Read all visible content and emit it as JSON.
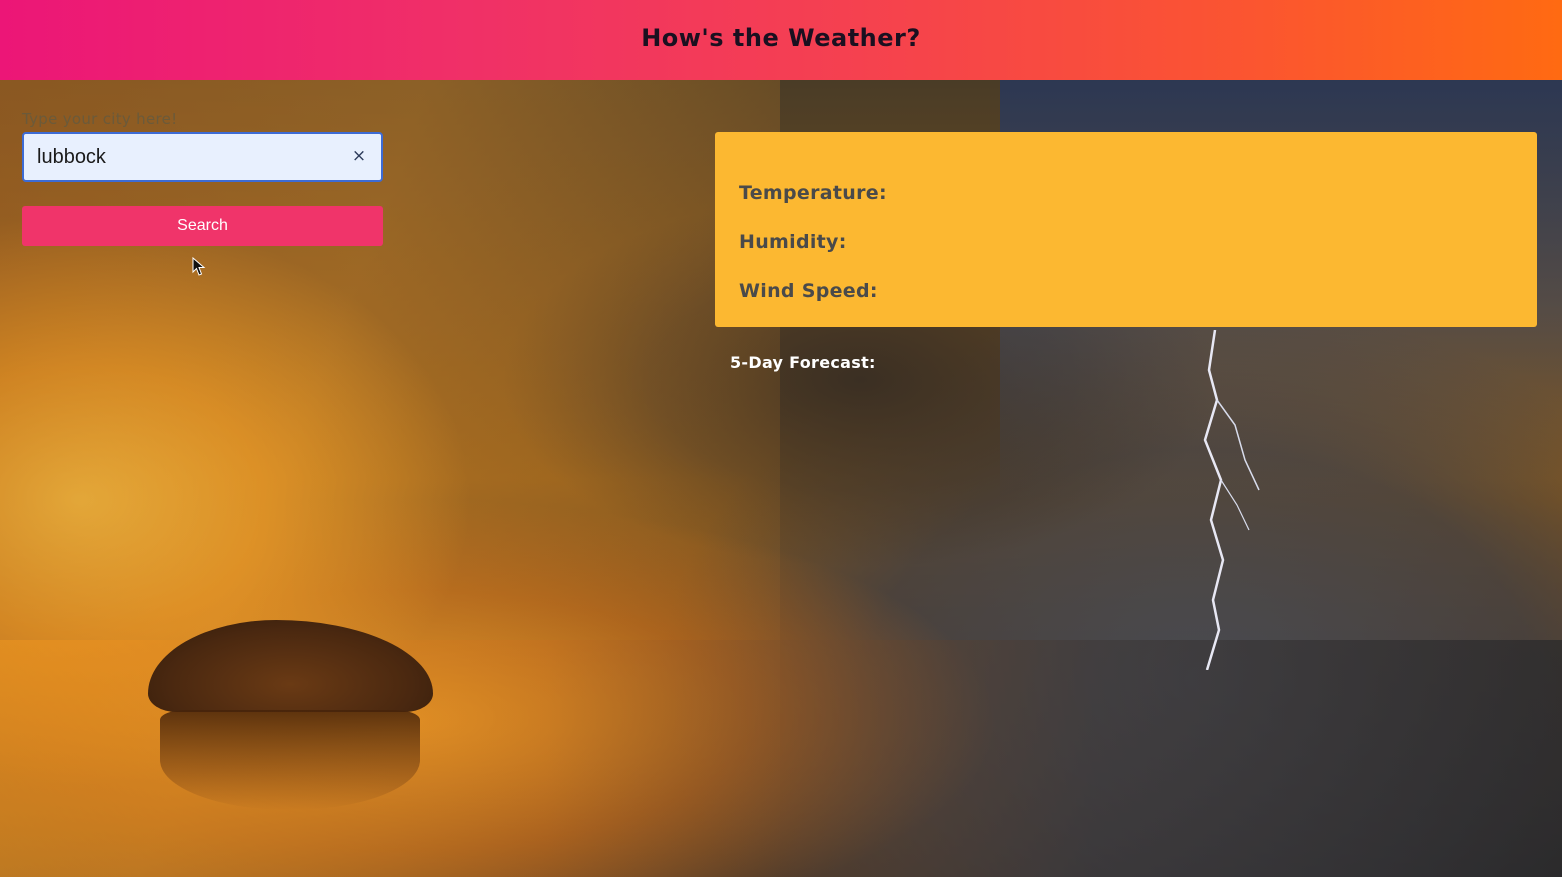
{
  "header": {
    "title": "How's the Weather?"
  },
  "search": {
    "label": "Type your city here!",
    "value": "lubbock",
    "clear_icon": "×",
    "button_label": "Search"
  },
  "current_weather": {
    "temperature_label": "Temperature:",
    "humidity_label": "Humidity:",
    "wind_speed_label": "Wind Speed:"
  },
  "forecast": {
    "heading": "5-Day Forecast:"
  },
  "colors": {
    "header_gradient_start": "#ec1677",
    "header_gradient_end": "#ff6a12",
    "search_button": "#f0346a",
    "weather_card": "#fcb831",
    "input_background": "#e8f0fe",
    "input_border": "#3d6bd4"
  }
}
